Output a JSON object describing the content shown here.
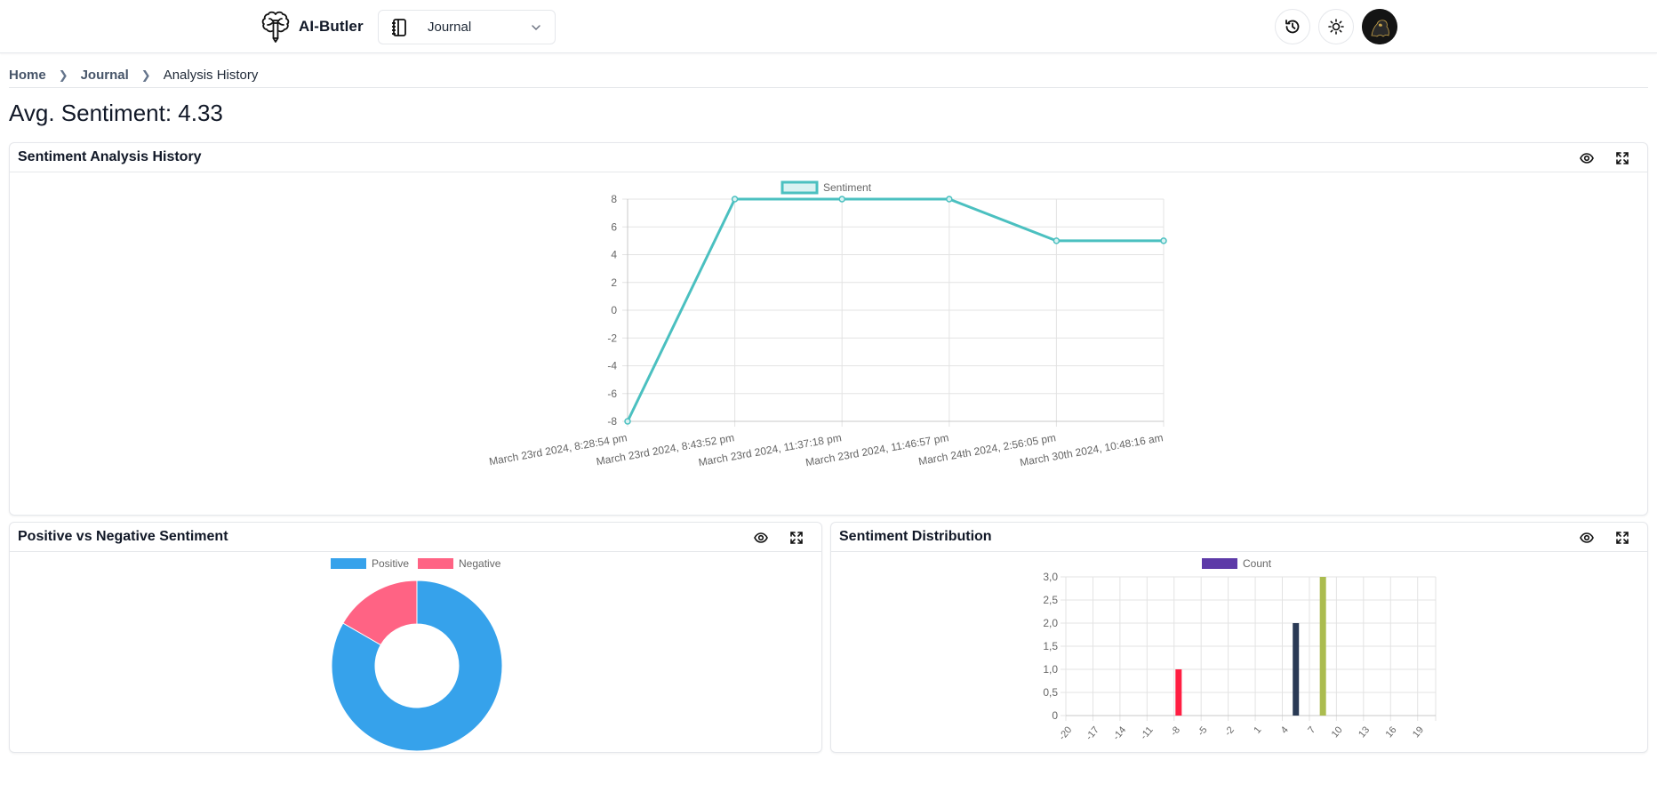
{
  "app": {
    "name": "AI-Butler",
    "logo_icon": "brain-pencil-icon"
  },
  "nav": {
    "journal_select": {
      "icon": "notebook-icon",
      "value": "Journal"
    },
    "history_button": {
      "icon": "history-icon"
    },
    "theme_button": {
      "icon": "sun-icon"
    },
    "avatar": {
      "icon": "user-avatar"
    }
  },
  "breadcrumb": [
    {
      "label": "Home"
    },
    {
      "label": "Journal"
    },
    {
      "label": "Analysis History"
    }
  ],
  "page_title": "Avg. Sentiment: 4.33",
  "cards": {
    "history": {
      "title": "Sentiment Analysis History",
      "actions": [
        "eye-icon",
        "expand-icon"
      ]
    },
    "posneg": {
      "title": "Positive vs Negative Sentiment",
      "actions": [
        "eye-icon",
        "expand-icon"
      ]
    },
    "dist": {
      "title": "Sentiment Distribution",
      "actions": [
        "eye-icon",
        "expand-icon"
      ]
    }
  },
  "chart_data": [
    {
      "type": "line",
      "title": "Sentiment Analysis History",
      "legend": {
        "entries": [
          "Sentiment"
        ],
        "placement": "top"
      },
      "color": "#4bc0c0",
      "fill_color": "#d9f2f2",
      "categories": [
        "March 23rd 2024, 8:28:54 pm",
        "March 23rd 2024, 8:43:52 pm",
        "March 23rd 2024, 11:37:18 pm",
        "March 23rd 2024, 11:46:57 pm",
        "March 24th 2024, 2:56:05 pm",
        "March 30th 2024, 10:48:16 am"
      ],
      "series": [
        {
          "name": "Sentiment",
          "values": [
            -8,
            8,
            8,
            8,
            5,
            5
          ]
        }
      ],
      "yticks": [
        8,
        6,
        4,
        2,
        0,
        -2,
        -4,
        -6,
        -8
      ],
      "ylim": [
        -8,
        8
      ],
      "grid": true,
      "xlabel": "",
      "ylabel": ""
    },
    {
      "type": "pie",
      "variant": "doughnut",
      "title": "Positive vs Negative Sentiment",
      "legend": {
        "entries": [
          "Positive",
          "Negative"
        ],
        "placement": "top"
      },
      "categories": [
        "Positive",
        "Negative"
      ],
      "values": [
        5,
        1
      ],
      "colors": [
        "#36a2eb",
        "#ff6384"
      ]
    },
    {
      "type": "bar",
      "title": "Sentiment Distribution",
      "legend": {
        "entries": [
          "Count"
        ],
        "placement": "top",
        "color": "#5d3aa8"
      },
      "x_range": [
        -20,
        20
      ],
      "xtick_labels": [
        "-20",
        "-17",
        "-14",
        "-11",
        "-8",
        "-5",
        "-2",
        "1",
        "4",
        "7",
        "10",
        "13",
        "16",
        "19"
      ],
      "bars": [
        {
          "x": -8,
          "value": 1,
          "color": "#ff1e42"
        },
        {
          "x": 5,
          "value": 2,
          "color": "#2a3a55"
        },
        {
          "x": 8,
          "value": 3,
          "color": "#abbc4f"
        }
      ],
      "yticks": [
        "3,0",
        "2,5",
        "2,0",
        "1,5",
        "1,0",
        "0,5",
        "0"
      ],
      "ylim": [
        0,
        3
      ],
      "grid": true,
      "xlabel": "",
      "ylabel": ""
    }
  ]
}
